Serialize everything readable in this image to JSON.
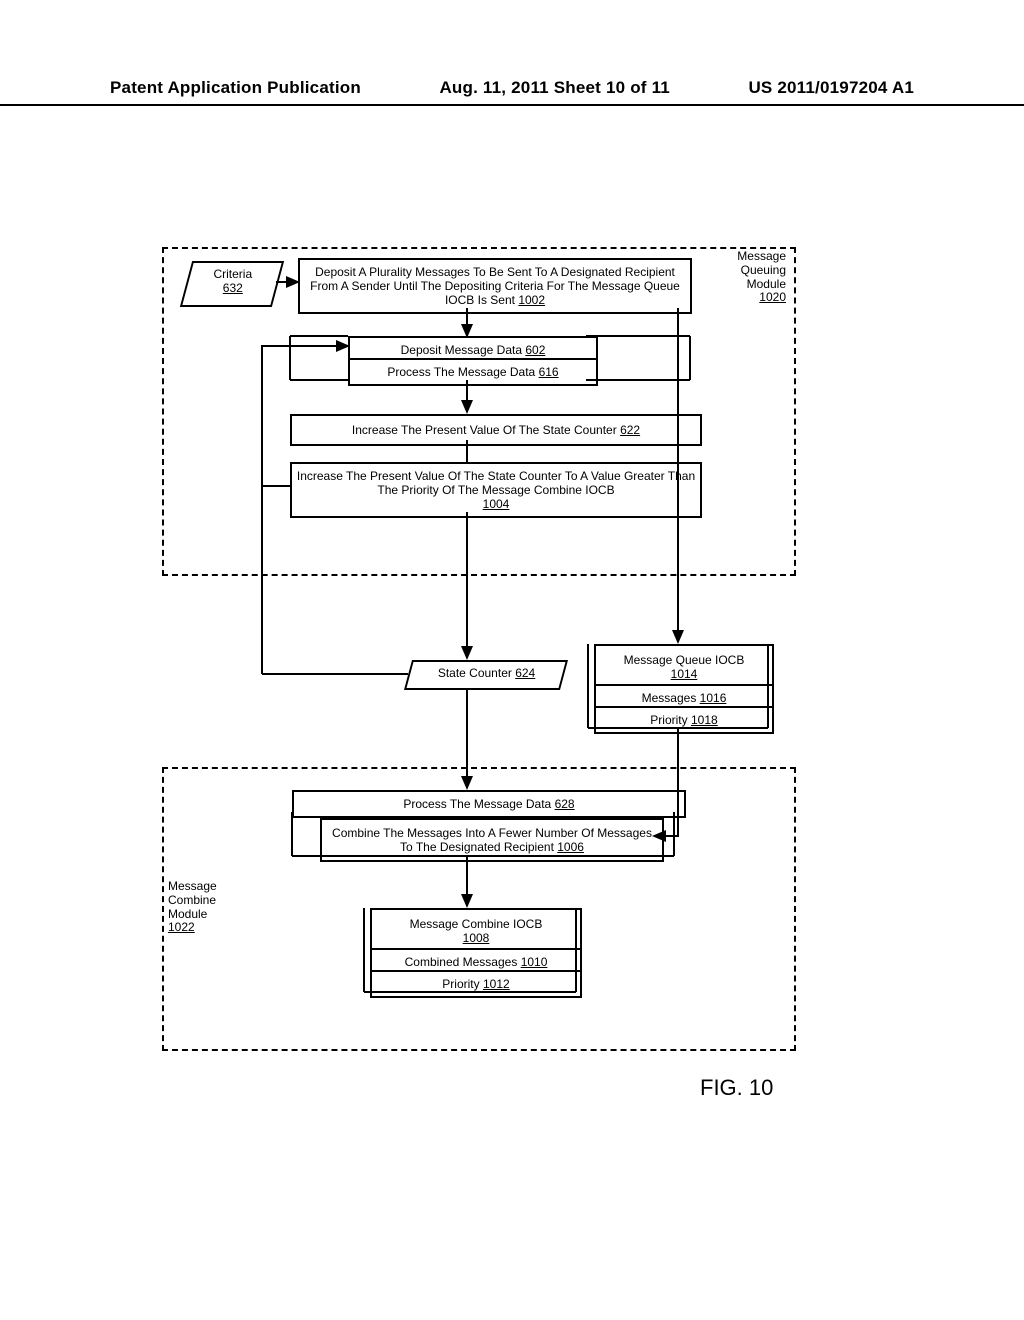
{
  "header": {
    "left": "Patent Application Publication",
    "mid": "Aug. 11, 2011  Sheet 10 of 11",
    "right": "US 2011/0197204 A1"
  },
  "criteria": {
    "label": "Criteria",
    "ref": "632"
  },
  "module_queuing": {
    "l1": "Message",
    "l2": "Queuing",
    "l3": "Module",
    "ref": "1020"
  },
  "deposit_block": {
    "text": "Deposit A Plurality Messages To Be Sent To A Designated Recipient From A Sender Until The Depositing Criteria For The Message Queue IOCB Is Sent",
    "ref": "1002"
  },
  "deposit_msg_data": {
    "text": "Deposit Message Data",
    "ref": "602"
  },
  "process_msg_data_top": {
    "text": "Process The Message Data",
    "ref": "616"
  },
  "increase_state": {
    "text": "Increase The Present Value Of The State Counter",
    "ref": "622"
  },
  "increase_state_priority": {
    "text": "Increase The Present Value Of The State Counter To A Value Greater Than The Priority Of The Message Combine IOCB",
    "ref": "1004"
  },
  "state_counter": {
    "label": "State Counter",
    "ref": "624"
  },
  "mq_iocb": {
    "title": "Message Queue IOCB",
    "title_ref": "1014",
    "messages": "Messages",
    "messages_ref": "1016",
    "priority": "Priority",
    "priority_ref": "1018"
  },
  "module_combine": {
    "l1": "Message",
    "l2": "Combine",
    "l3": "Module",
    "ref": "1022"
  },
  "process_msg_data_bottom": {
    "text": "Process The Message Data",
    "ref": "628"
  },
  "combine_messages": {
    "text": "Combine The Messages Into A Fewer Number Of Messages To The Designated Recipient",
    "ref": "1006"
  },
  "mc_iocb": {
    "title": "Message Combine IOCB",
    "title_ref": "1008",
    "combined": "Combined Messages",
    "combined_ref": "1010",
    "priority": "Priority",
    "priority_ref": "1012"
  },
  "figure": "FIG. 10"
}
